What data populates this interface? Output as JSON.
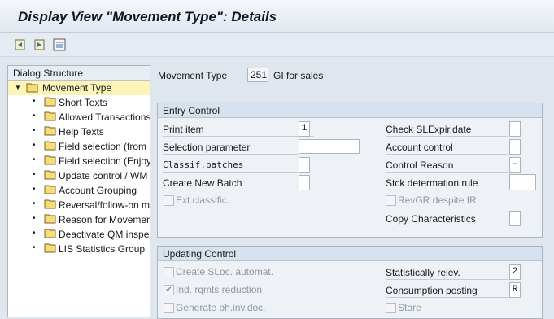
{
  "window": {
    "title": "Display View \"Movement Type\": Details"
  },
  "toolbar": {
    "icons": [
      "prev-entry-icon",
      "next-entry-icon",
      "variable-list-icon"
    ]
  },
  "dialog_structure": {
    "header": "Dialog Structure",
    "root": "Movement Type",
    "items": [
      "Short Texts",
      "Allowed Transactions",
      "Help Texts",
      "Field selection (from",
      "Field selection (Enjoy",
      "Update control / WM",
      "Account Grouping",
      "Reversal/follow-on m",
      "Reason for Movement",
      "Deactivate QM inspe",
      "LIS Statistics Group"
    ]
  },
  "movement_type": {
    "label": "Movement Type",
    "value": "251",
    "description": "GI for sales"
  },
  "entry_control": {
    "header": "Entry Control",
    "print_item": {
      "label": "Print item",
      "value": "1"
    },
    "selection_parameter": {
      "label": "Selection parameter",
      "value": ""
    },
    "classif_batches": {
      "label": "Classif.batches",
      "value": ""
    },
    "create_new_batch": {
      "label": "Create New Batch",
      "value": ""
    },
    "ext_classific": {
      "label": "Ext.classific.",
      "checked": false
    },
    "check_slexpir": {
      "label": "Check SLExpir.date",
      "value": ""
    },
    "account_control": {
      "label": "Account control",
      "value": ""
    },
    "control_reason": {
      "label": "Control Reason",
      "value": "–"
    },
    "stck_determination": {
      "label": "Stck determation rule",
      "value": ""
    },
    "revgr": {
      "label": "RevGR despite IR",
      "checked": false
    },
    "copy_characteristics": {
      "label": "Copy Characteristics",
      "value": ""
    }
  },
  "updating_control": {
    "header": "Updating Control",
    "create_sloc": {
      "label": "Create SLoc. automat.",
      "checked": false
    },
    "ind_rqmts": {
      "label": "Ind. rqmts reduction",
      "checked": true
    },
    "generate_phinv": {
      "label": "Generate ph.inv.doc.",
      "checked": false
    },
    "statistically_relev": {
      "label": "Statistically relev.",
      "value": "2"
    },
    "consumption_posting": {
      "label": "Consumption posting",
      "value": "R"
    },
    "store": {
      "label": "Store",
      "checked": false
    }
  }
}
